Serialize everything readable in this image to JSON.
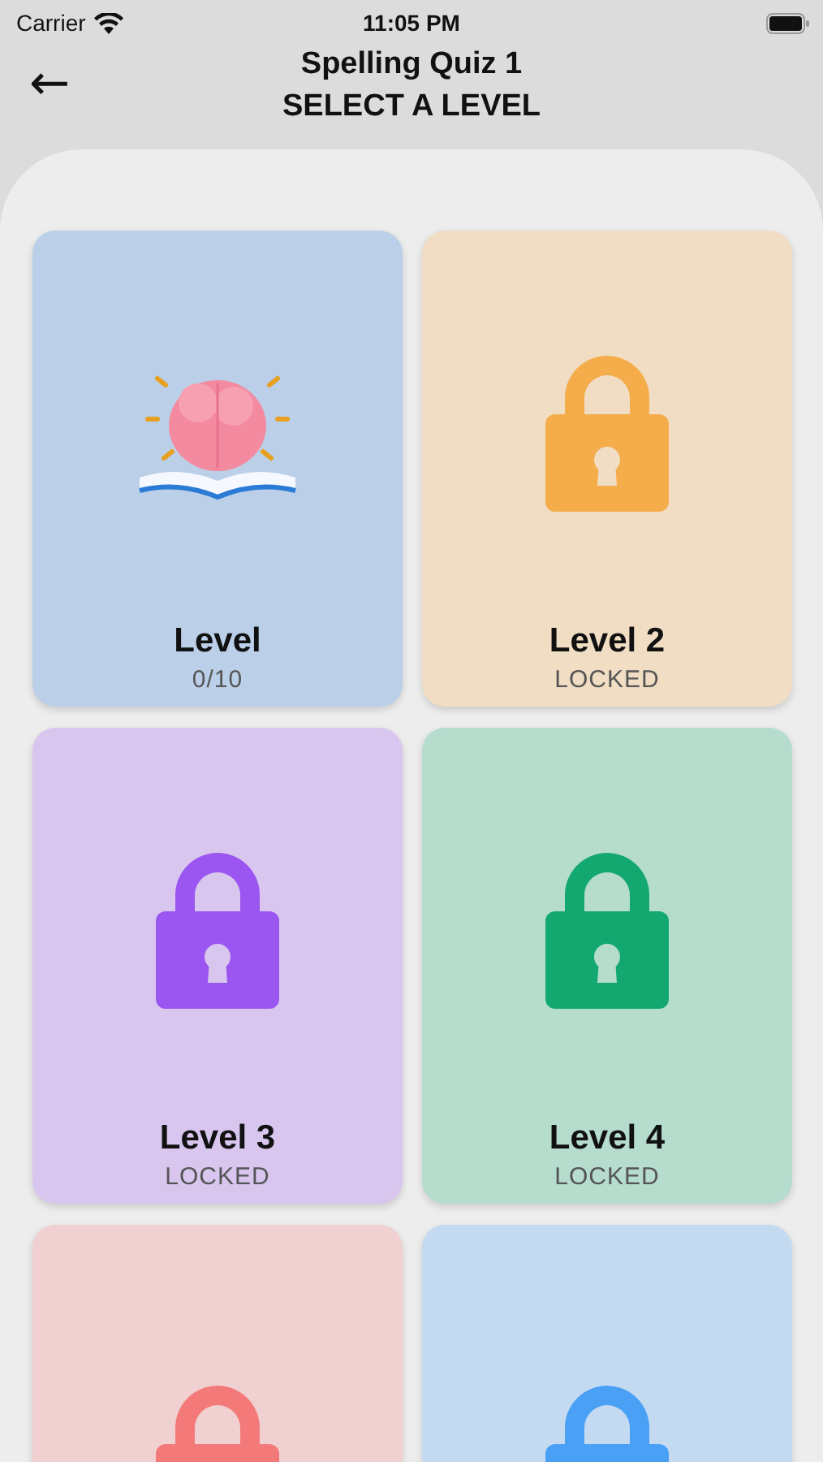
{
  "status_bar": {
    "carrier": "Carrier",
    "time": "11:05 PM"
  },
  "header": {
    "back_icon": "←",
    "title": "Spelling Quiz 1",
    "subtitle": "SELECT A LEVEL"
  },
  "levels": [
    {
      "title": "Level",
      "subtitle": "0/10",
      "locked": false,
      "color": "#2a7bd6"
    },
    {
      "title": "Level 2",
      "subtitle": "LOCKED",
      "locked": true,
      "color": "#f4ad4a"
    },
    {
      "title": "Level 3",
      "subtitle": "LOCKED",
      "locked": true,
      "color": "#9b55f0"
    },
    {
      "title": "Level 4",
      "subtitle": "LOCKED",
      "locked": true,
      "color": "#12a870"
    },
    {
      "locked": true,
      "color": "#f47a7a"
    },
    {
      "locked": true,
      "color": "#4aa0f5"
    }
  ]
}
